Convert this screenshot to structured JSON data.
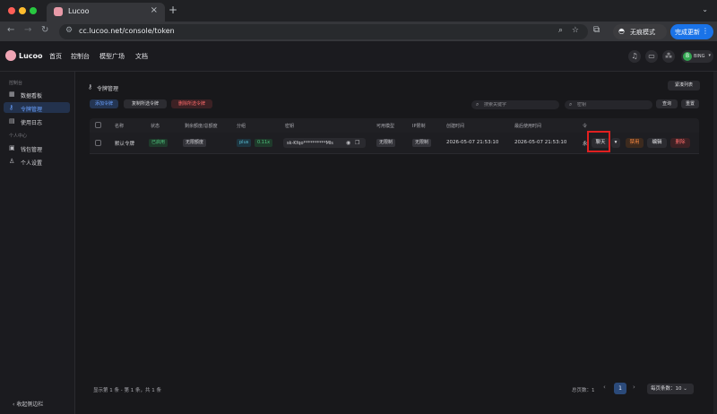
{
  "browser": {
    "tab_title": "Lucoo",
    "url": "cc.lucoo.net/console/token",
    "incognito_label": "无痕模式",
    "update_label": "完成更新"
  },
  "header": {
    "brand": "Lucoo",
    "nav": [
      "首页",
      "控制台",
      "模型广场",
      "文档"
    ],
    "avatar_letter": "B",
    "user_name": "BING"
  },
  "sidebar": {
    "group_console": "控制台",
    "items_console": [
      {
        "label": "数据看板",
        "icon": "chart-icon"
      },
      {
        "label": "令牌管理",
        "icon": "key-icon",
        "active": true
      },
      {
        "label": "使用日志",
        "icon": "log-icon"
      }
    ],
    "group_personal": "个人中心",
    "items_personal": [
      {
        "label": "钱包管理",
        "icon": "wallet-icon"
      },
      {
        "label": "个人设置",
        "icon": "user-icon"
      }
    ],
    "collapse_label": "收起侧边栏"
  },
  "main": {
    "title": "令牌管理",
    "compact_label": "紧凑列表",
    "add_label": "添加令牌",
    "copy_label": "复制所选令牌",
    "delete_selected_label": "删除所选令牌",
    "search_keyword_placeholder": "搜索关键字",
    "search_key_placeholder": "密钥",
    "query_label": "查询",
    "reset_label": "重置"
  },
  "table": {
    "columns": [
      "名称",
      "状态",
      "剩余额度/总额度",
      "分组",
      "密钥",
      "可用模型",
      "IP限制",
      "创建时间",
      "最后使用时间",
      "令"
    ],
    "row": {
      "name": "默认令牌",
      "status": "已启用",
      "quota": "无限额度",
      "group": "plus",
      "group_rate": "0.11x",
      "key": "sk-Kfqo**********Mls",
      "models": "无限制",
      "ip_limit": "无限制",
      "created": "2026-05-07 21:53:10",
      "last_used": "2026-05-07 21:53:10",
      "expire_partial": "永",
      "actions": {
        "chat": "聊天",
        "disable": "禁用",
        "edit": "编辑",
        "delete": "删除"
      }
    }
  },
  "footer": {
    "info": "显示第 1 条 - 第 1 条，共 1 条",
    "total": "总页数：1",
    "page": "1",
    "page_size": "每页条数：10"
  },
  "colors": {
    "accent": "#1a73e8",
    "active_nav": "#6aa1ff",
    "highlight_box": "#e02020"
  }
}
